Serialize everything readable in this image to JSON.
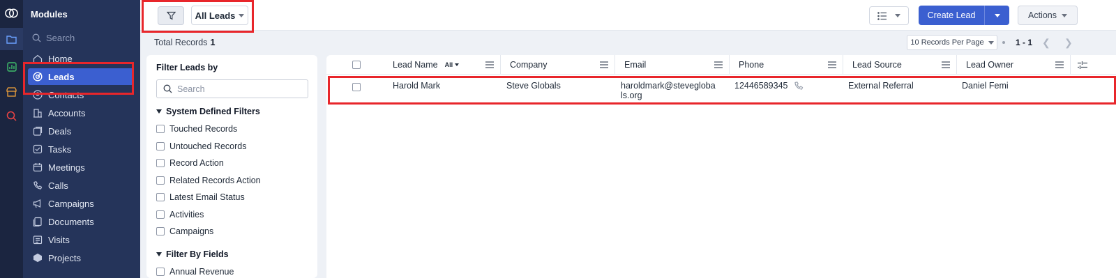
{
  "sidebar": {
    "title": "Modules",
    "search_placeholder": "Search",
    "items": [
      {
        "label": "Home"
      },
      {
        "label": "Leads"
      },
      {
        "label": "Contacts"
      },
      {
        "label": "Accounts"
      },
      {
        "label": "Deals"
      },
      {
        "label": "Tasks"
      },
      {
        "label": "Meetings"
      },
      {
        "label": "Calls"
      },
      {
        "label": "Campaigns"
      },
      {
        "label": "Documents"
      },
      {
        "label": "Visits"
      },
      {
        "label": "Projects"
      }
    ],
    "active_item": "Leads"
  },
  "toolbar": {
    "view_label": "All Leads",
    "create_label": "Create Lead",
    "actions_label": "Actions"
  },
  "records": {
    "total_label": "Total Records",
    "total_count": "1",
    "per_page_label": "10 Records Per Page",
    "range": "1 - 1"
  },
  "filter_panel": {
    "title": "Filter Leads by",
    "search_placeholder": "Search",
    "system_section": "System Defined Filters",
    "system_filters": [
      "Touched Records",
      "Untouched Records",
      "Record Action",
      "Related Records Action",
      "Latest Email Status",
      "Activities",
      "Campaigns"
    ],
    "fields_section": "Filter By Fields",
    "fields_first": "Annual Revenue"
  },
  "table": {
    "columns": [
      "Lead Name",
      "Company",
      "Email",
      "Phone",
      "Lead Source",
      "Lead Owner"
    ],
    "name_filter": "All",
    "rows": [
      {
        "lead_name": "Harold Mark",
        "company": "Steve Globals",
        "email_line1": "haroldmark@stevegloba",
        "email_line2": "ls.org",
        "phone": "12446589345",
        "lead_source": "External Referral",
        "lead_owner": "Daniel Femi"
      }
    ]
  },
  "colors": {
    "rail": "#1b2540",
    "sidebar": "#25345a",
    "active_item": "#3b5fd0",
    "primary_button": "#3b5fd0",
    "highlight": "#e8262b"
  }
}
